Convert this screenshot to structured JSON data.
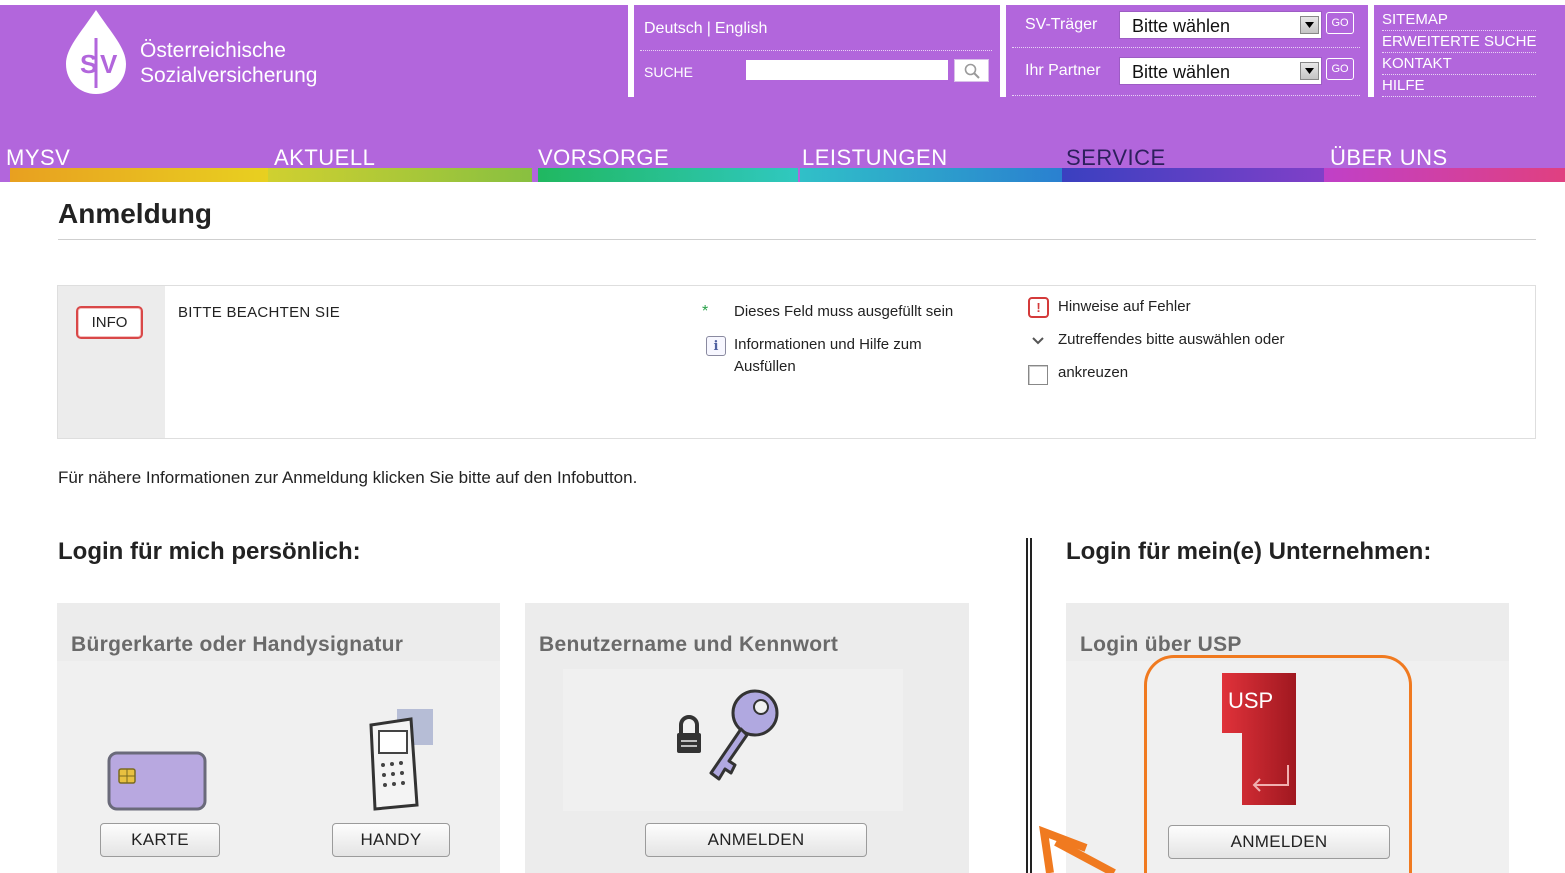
{
  "header": {
    "logo_mark": "SV",
    "logo_line1": "Österreichische",
    "logo_line2": "Sozialversicherung",
    "lang_de": "Deutsch",
    "lang_sep": "|",
    "lang_en": "English",
    "search_label": "SUCHE",
    "search_value": "",
    "sv_traeger_label": "SV-Träger",
    "sv_traeger_value": "Bitte wählen",
    "partner_label": "Ihr Partner",
    "partner_value": "Bitte wählen",
    "go_label": "GO",
    "quick_links": [
      "SITEMAP",
      "ERWEITERTE SUCHE",
      "KONTAKT",
      "HILFE"
    ],
    "colors": {
      "header_bg": "#b266dc",
      "accent_orange": "#f07a20"
    }
  },
  "nav": {
    "items": [
      {
        "label": "MYSV",
        "active": false,
        "color": "#e8d020"
      },
      {
        "label": "AKTUELL",
        "active": false,
        "color": "#a8cc3a"
      },
      {
        "label": "VORSORGE",
        "active": false,
        "color": "#2cc080"
      },
      {
        "label": "LEISTUNGEN",
        "active": false,
        "color": "#2aa8d8"
      },
      {
        "label": "SERVICE",
        "active": true,
        "color": "#5040c0"
      },
      {
        "label": "ÜBER UNS",
        "active": false,
        "color": "#d040a0"
      }
    ]
  },
  "page": {
    "title": "Anmeldung",
    "info": {
      "button_label": "INFO",
      "heading": "BITTE BEACHTEN SIE",
      "required_star": "*",
      "required_text": "Dieses Feld muss ausgefüllt sein",
      "info_icon_glyph": "i",
      "info_text_line1": "Informationen und Hilfe zum",
      "info_text_line2": "Ausfüllen",
      "error_icon_glyph": "!",
      "error_text": "Hinweise auf Fehler",
      "select_text": "Zutreffendes bitte auswählen oder",
      "checkbox_text": "ankreuzen"
    },
    "note": "Für nähere Informationen zur Anmeldung klicken Sie bitte auf den Infobutton.",
    "personal": {
      "heading": "Login für mich persönlich:",
      "buergerkarte_title": "Bürgerkarte oder Handysignatur",
      "karte_button": "KARTE",
      "handy_button": "HANDY",
      "benutzer_title": "Benutzername und Kennwort",
      "benutzer_button": "ANMELDEN"
    },
    "company": {
      "heading": "Login für mein(e) Unternehmen:",
      "usp_title": "Login über USP",
      "usp_logo_text": "USP",
      "usp_button": "ANMELDEN"
    }
  }
}
